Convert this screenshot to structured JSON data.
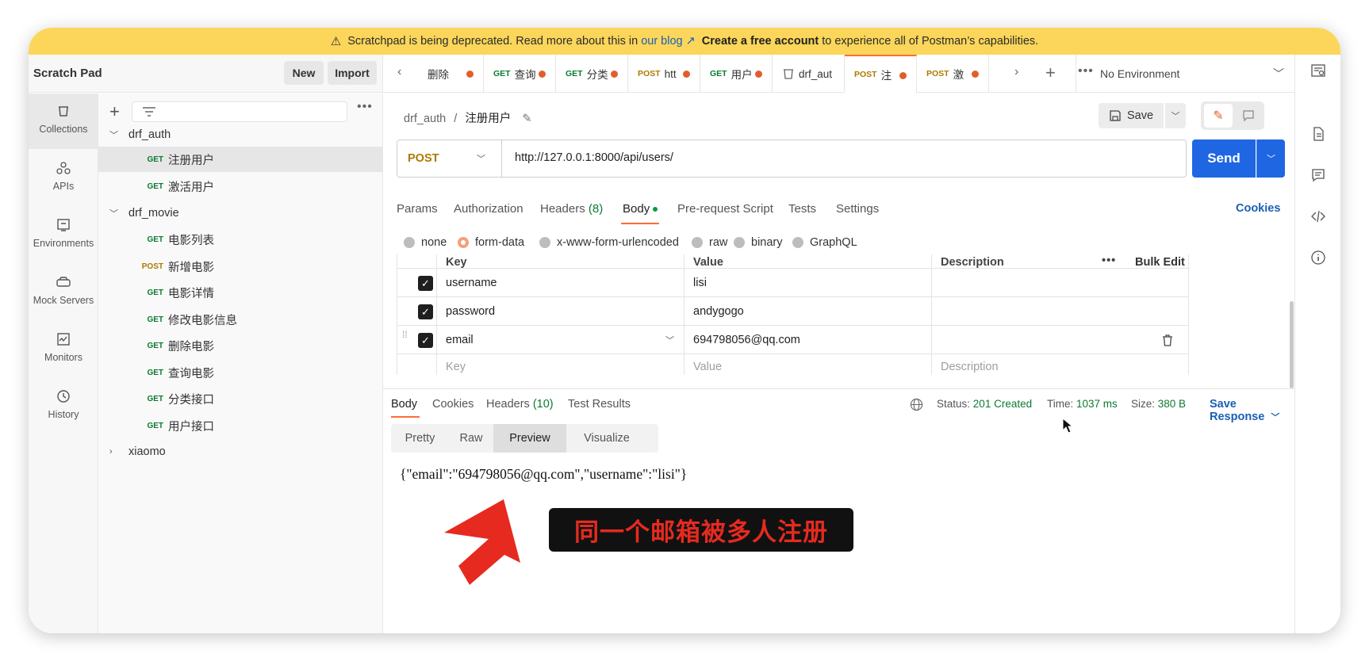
{
  "banner": {
    "pre": "Scratchpad is being deprecated. Read more about this in",
    "link": "our blog ↗",
    "bold": "Create a free account",
    "post": "to experience all of Postman’s capabilities."
  },
  "left_header": {
    "title": "Scratch Pad",
    "new_label": "New",
    "import_label": "Import"
  },
  "rail": [
    {
      "label": "Collections",
      "icon": "collections-icon"
    },
    {
      "label": "APIs",
      "icon": "apis-icon"
    },
    {
      "label": "Environments",
      "icon": "environments-icon"
    },
    {
      "label": "Mock Servers",
      "icon": "mock-servers-icon"
    },
    {
      "label": "Monitors",
      "icon": "monitors-icon"
    },
    {
      "label": "History",
      "icon": "history-icon"
    }
  ],
  "tree": {
    "drf_auth": "drf_auth",
    "auth_items": [
      {
        "method": "GET",
        "name": "注册用户"
      },
      {
        "method": "GET",
        "name": "激活用户"
      }
    ],
    "drf_movie": "drf_movie",
    "movie_items": [
      {
        "method": "GET",
        "name": "电影列表"
      },
      {
        "method": "POST",
        "name": "新增电影"
      },
      {
        "method": "GET",
        "name": "电影详情"
      },
      {
        "method": "GET",
        "name": "修改电影信息"
      },
      {
        "method": "GET",
        "name": "删除电影"
      },
      {
        "method": "GET",
        "name": "查询电影"
      },
      {
        "method": "GET",
        "name": "分类接口"
      },
      {
        "method": "GET",
        "name": "用户接口"
      }
    ],
    "xiaomo": "xiaomo"
  },
  "tabs": [
    {
      "method": "",
      "name": "删除"
    },
    {
      "method": "GET",
      "name": "查询"
    },
    {
      "method": "GET",
      "name": "分类"
    },
    {
      "method": "POST",
      "name": "htt"
    },
    {
      "method": "GET",
      "name": "用户"
    },
    {
      "method": "",
      "name": "drf_aut"
    },
    {
      "method": "POST",
      "name": "注"
    },
    {
      "method": "POST",
      "name": "激"
    }
  ],
  "environment": "No Environment",
  "request": {
    "breadcrumb_parent": "drf_auth",
    "breadcrumb_sep": "/",
    "breadcrumb_current": "注册用户",
    "save_label": "Save",
    "method": "POST",
    "url": "http://127.0.0.1:8000/api/users/",
    "send_label": "Send",
    "tabs": {
      "params": "Params",
      "authorization": "Authorization",
      "headers": "Headers",
      "headers_count": "(8)",
      "body": "Body",
      "prerequest": "Pre-request Script",
      "tests": "Tests",
      "settings": "Settings"
    },
    "cookies_label": "Cookies",
    "body_types": [
      "none",
      "form-data",
      "x-www-form-urlencoded",
      "raw",
      "binary",
      "GraphQL"
    ],
    "kv_headers": {
      "key": "Key",
      "value": "Value",
      "description": "Description",
      "bulk_edit": "Bulk Edit"
    },
    "kv_rows": [
      {
        "key": "username",
        "value": "lisi"
      },
      {
        "key": "password",
        "value": "andygogo"
      },
      {
        "key": "email",
        "value": "694798056@qq.com"
      }
    ],
    "kv_placeholder": {
      "key": "Key",
      "value": "Value",
      "description": "Description"
    }
  },
  "response": {
    "tabs": {
      "body": "Body",
      "cookies": "Cookies",
      "headers": "Headers",
      "headers_count": "(10)",
      "tests": "Test Results"
    },
    "status_label": "Status:",
    "status_value": "201 Created",
    "time_label": "Time:",
    "time_value": "1037 ms",
    "size_label": "Size:",
    "size_value": "380 B",
    "save_label": "Save Response",
    "views": [
      "Pretty",
      "Raw",
      "Preview",
      "Visualize"
    ],
    "body_text": "{\"email\":\"694798056@qq.com\",\"username\":\"lisi\"}"
  },
  "overlay_caption": "同一个邮箱被多人注册"
}
